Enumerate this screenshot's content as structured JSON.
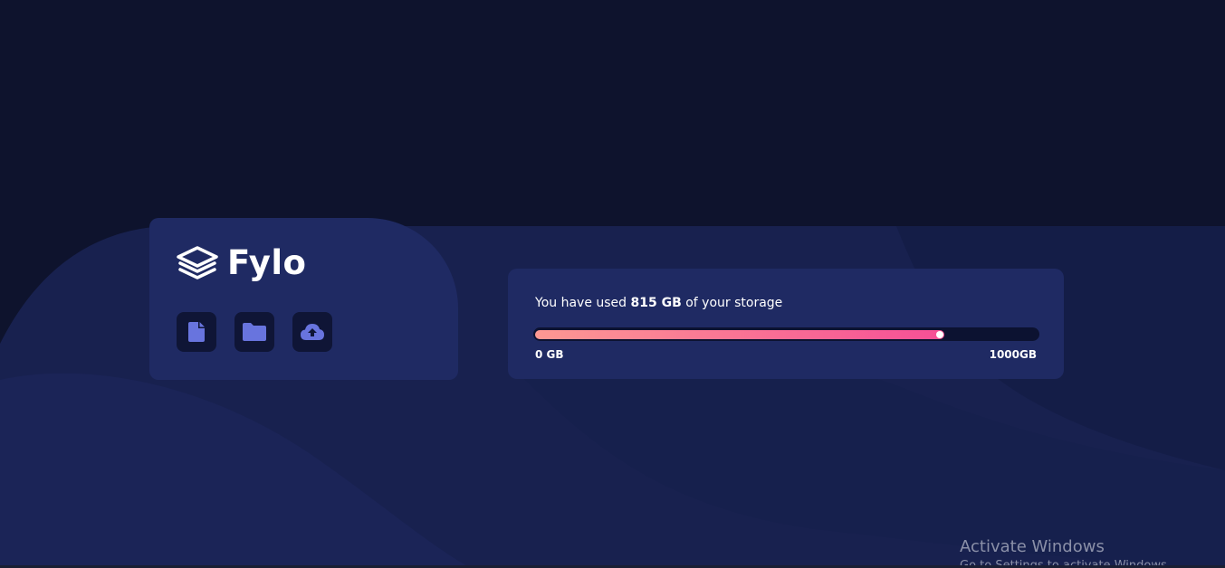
{
  "app": {
    "brand_name": "Fylo"
  },
  "toolbar": {
    "buttons": [
      {
        "icon": "document-icon"
      },
      {
        "icon": "folder-icon"
      },
      {
        "icon": "cloud-upload-icon"
      }
    ]
  },
  "storage": {
    "prefix": "You have used ",
    "used_amount": "815 GB",
    "suffix": " of your storage",
    "used_value": 815,
    "total_value": 1000,
    "min_label": "0 GB",
    "max_label": "1000GB"
  },
  "system_overlay": {
    "title": "Activate Windows",
    "subtitle": "Go to Settings to activate Windows."
  },
  "colors": {
    "background": "#0e132d",
    "card": "#1f2a63",
    "icon_button": "#0f1536",
    "icon": "#6874de",
    "gradient_start": "#fd9893",
    "gradient_end": "#f64f96",
    "track": "#0c1231"
  }
}
